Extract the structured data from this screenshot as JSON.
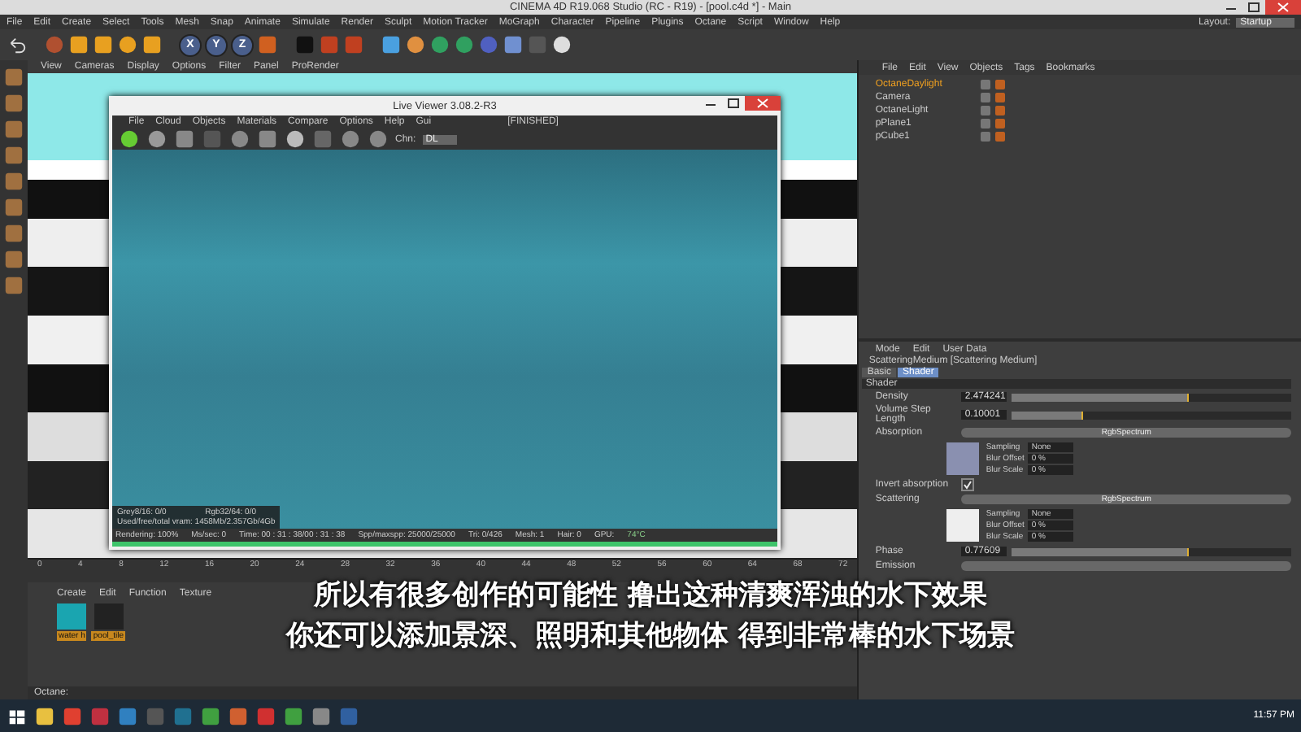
{
  "window": {
    "title": "CINEMA 4D R19.068 Studio (RC - R19) - [pool.c4d *] - Main"
  },
  "menu_bar": [
    "File",
    "Edit",
    "Create",
    "Select",
    "Tools",
    "Mesh",
    "Snap",
    "Animate",
    "Simulate",
    "Render",
    "Sculpt",
    "Motion Tracker",
    "MoGraph",
    "Character",
    "Pipeline",
    "Plugins",
    "Octane",
    "Script",
    "Window",
    "Help"
  ],
  "layout": {
    "label": "Layout:",
    "value": "Startup"
  },
  "axis_buttons": [
    "X",
    "Y",
    "Z"
  ],
  "viewport": {
    "menu": [
      "View",
      "Cameras",
      "Display",
      "Options",
      "Filter",
      "Panel",
      "ProRender"
    ]
  },
  "object_manager": {
    "menu": [
      "File",
      "Edit",
      "View",
      "Objects",
      "Tags",
      "Bookmarks"
    ],
    "objects": [
      {
        "name": "OctaneDaylight",
        "selected": true
      },
      {
        "name": "Camera",
        "selected": false
      },
      {
        "name": "OctaneLight",
        "selected": false
      },
      {
        "name": "pPlane1",
        "selected": false
      },
      {
        "name": "pCube1",
        "selected": false
      }
    ]
  },
  "attributes": {
    "menu": [
      "Mode",
      "Edit",
      "User Data"
    ],
    "title": "ScatteringMedium [Scattering Medium]",
    "tabs": [
      {
        "label": "Basic",
        "selected": false
      },
      {
        "label": "Shader",
        "selected": true
      }
    ],
    "section": "Shader",
    "rows": [
      {
        "kind": "slider",
        "label": "Density",
        "value": "2.474241",
        "level": 0.63
      },
      {
        "kind": "slider",
        "label": "Volume Step Length",
        "value": "0.10001",
        "level": 0.25
      },
      {
        "kind": "shader",
        "label": "Absorption",
        "shader": "RgbSpectrum",
        "color": "#8a90b0",
        "fields": [
          {
            "label": "Sampling",
            "value": "None"
          },
          {
            "label": "Blur Offset",
            "value": "0 %"
          },
          {
            "label": "Blur Scale",
            "value": "0 %"
          }
        ]
      },
      {
        "kind": "checkbox",
        "label": "Invert absorption",
        "checked": true
      },
      {
        "kind": "shader",
        "label": "Scattering",
        "shader": "RgbSpectrum",
        "color": "#eeeeee",
        "fields": [
          {
            "label": "Sampling",
            "value": "None"
          },
          {
            "label": "Blur Offset",
            "value": "0 %"
          },
          {
            "label": "Blur Scale",
            "value": "0 %"
          }
        ]
      },
      {
        "kind": "slider",
        "label": "Phase",
        "value": "0.77609",
        "level": 0.63
      },
      {
        "kind": "shader",
        "label": "Emission",
        "shader": ""
      }
    ]
  },
  "timeline": {
    "ticks": [
      "0",
      "4",
      "8",
      "12",
      "16",
      "20",
      "24",
      "28",
      "32",
      "36",
      "40",
      "44",
      "48",
      "52",
      "56",
      "60",
      "64",
      "68",
      "72"
    ]
  },
  "material_manager": {
    "menu": [
      "Create",
      "Edit",
      "Function",
      "Texture"
    ],
    "materials": [
      {
        "name": "water h",
        "color": "#1aa5b0"
      },
      {
        "name": "pool_tile",
        "color": "#222222"
      }
    ]
  },
  "status_bar": "Octane:",
  "live_viewer": {
    "title": "Live Viewer 3.08.2-R3",
    "menu": [
      "File",
      "Cloud",
      "Objects",
      "Materials",
      "Compare",
      "Options",
      "Help",
      "Gui"
    ],
    "state": "[FINISHED]",
    "channel_label": "Chn:",
    "channel": "DL",
    "info": [
      "Grey8/16: 0/0",
      "Rgb32/64: 0/0",
      "Used/free/total vram: 1458Mb/2.357Gb/4Gb"
    ],
    "status": [
      "Rendering: 100%",
      "Ms/sec: 0",
      "Time: 00 : 31 : 38/00 : 31 : 38",
      "Spp/maxspp: 25000/25000",
      "Tri: 0/426",
      "Mesh: 1",
      "Hair: 0",
      "GPU:",
      "74°C"
    ],
    "level": 1
  },
  "subtitles": [
    "所以有很多创作的可能性 撸出这种清爽浑浊的水下效果",
    "你还可以添加景深、照明和其他物体 得到非常棒的水下场景"
  ],
  "taskbar": {
    "clock": "11:57 PM"
  }
}
